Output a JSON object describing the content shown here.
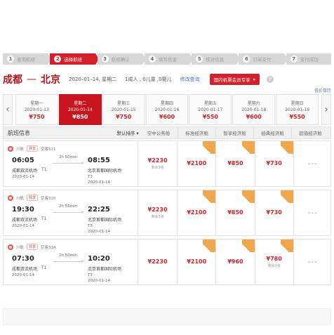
{
  "steps": [
    {
      "n": "1",
      "label": "查询航班",
      "state": "inactive"
    },
    {
      "n": "2",
      "label": "选择航班",
      "state": "active"
    },
    {
      "n": "3",
      "label": "航班确认",
      "state": "inactive"
    },
    {
      "n": "4",
      "label": "填写信息",
      "state": "inactive"
    },
    {
      "n": "5",
      "label": "核对信息",
      "state": "inactive"
    },
    {
      "n": "6",
      "label": "订单支付",
      "state": "inactive"
    },
    {
      "n": "7",
      "label": "支付成功",
      "state": "inactive"
    }
  ],
  "route": {
    "from": "成都",
    "sep": "—",
    "to": "北京",
    "date_text": "2020–01–14, 星期二",
    "pax_text": "1成人 , 0儿童 ,0婴儿",
    "modify": "修改查询",
    "promo": "国内机票会员专享",
    "help": "?"
  },
  "price_calendar": "低价日历",
  "datestrip": {
    "days": [
      {
        "w": "星期一",
        "d": "2020-01-13",
        "p": "¥750",
        "active": false
      },
      {
        "w": "星期二",
        "d": "2020-01-14",
        "p": "¥850",
        "active": true
      },
      {
        "w": "星期三",
        "d": "2020-01-15",
        "p": "¥750",
        "active": false
      },
      {
        "w": "星期四",
        "d": "2020-01-16",
        "p": "¥600",
        "active": false
      },
      {
        "w": "星期五",
        "d": "2020-01-17",
        "p": "¥550",
        "active": false
      },
      {
        "w": "星期六",
        "d": "2020-01-18",
        "p": "¥600",
        "active": false
      },
      {
        "w": "星期日",
        "d": "2020-01-19",
        "p": "¥550",
        "active": false
      }
    ],
    "left_arrow": "‹",
    "right_arrow": "›"
  },
  "table": {
    "headers": {
      "info": "航班信息",
      "sort": "默认排序 ▾",
      "cols": [
        "空中公务舱",
        "标准经济舱",
        "智享经济舱",
        "经典经济舱",
        "超值经济舱"
      ]
    },
    "rows": [
      {
        "airline": "川航",
        "tag": "共享",
        "aircraft": "空客321",
        "dep_time": "06:05",
        "dep_ap": "成都双流机场",
        "dep_term": "T1",
        "dep_date": "2020-01-14",
        "duration": "2h 50min",
        "arr_time": "08:55",
        "arr_ap": "北京首都国际机场",
        "arr_term": "T3",
        "arr_date": "2020-01-14",
        "prices": [
          {
            "text": "¥2230",
            "sub": "剩余3张",
            "ribbon": false
          },
          {
            "text": "¥2100",
            "sub": "",
            "ribbon": true
          },
          {
            "text": "¥850",
            "sub": "",
            "ribbon": true
          },
          {
            "text": "¥730",
            "sub": "",
            "ribbon": true
          },
          {
            "text": "---",
            "sub": "",
            "ribbon": false
          }
        ]
      },
      {
        "airline": "川航",
        "tag": "共享",
        "aircraft": "空客320",
        "dep_time": "19:30",
        "dep_ap": "成都双流机场",
        "dep_term": "T1",
        "dep_date": "2020-01-14",
        "duration": "2h 55min",
        "arr_time": "22:25",
        "arr_ap": "北京首都国际机场",
        "arr_term": "T3",
        "arr_date": "2020-01-14",
        "prices": [
          {
            "text": "¥2230",
            "sub": "剩余3张",
            "ribbon": false
          },
          {
            "text": "¥2100",
            "sub": "",
            "ribbon": true
          },
          {
            "text": "¥850",
            "sub": "",
            "ribbon": true
          },
          {
            "text": "¥730",
            "sub": "",
            "ribbon": true
          },
          {
            "text": "---",
            "sub": "",
            "ribbon": false
          }
        ]
      },
      {
        "airline": "川航",
        "tag": "共享",
        "aircraft": "空客33A",
        "dep_time": "07:30",
        "dep_ap": "成都双流机场",
        "dep_term": "T1",
        "dep_date": "2020-01-14",
        "duration": "2h 50min",
        "arr_time": "10:20",
        "arr_ap": "北京首都国际机场",
        "arr_term": "T3",
        "arr_date": "2020-01-14",
        "prices": [
          {
            "text": "¥2230",
            "sub": "",
            "ribbon": false
          },
          {
            "text": "¥2100",
            "sub": "",
            "ribbon": true
          },
          {
            "text": "¥960",
            "sub": "",
            "ribbon": true
          },
          {
            "text": "¥780",
            "sub": "剩余3张",
            "ribbon": true
          },
          {
            "text": "---",
            "sub": "",
            "ribbon": false
          }
        ]
      }
    ]
  },
  "colors": {
    "red": "#d3202a",
    "orange": "#f0a64a",
    "step_gray": "#d7d7d7"
  }
}
